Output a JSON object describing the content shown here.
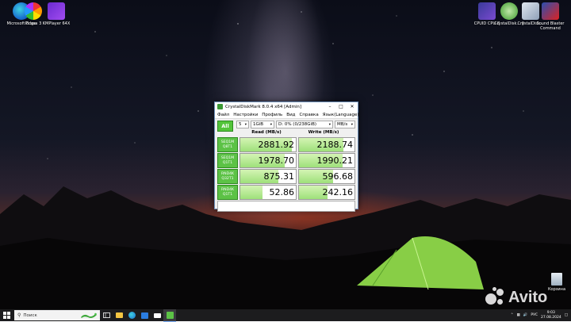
{
  "desktop": {
    "icons_left": [
      {
        "label": "Microsoft Edge",
        "icon": "edge-icon"
      },
      {
        "label": "Picasa 3",
        "icon": "picasa-icon"
      },
      {
        "label": "KMPlayer 64X",
        "icon": "kmplayer-icon"
      }
    ],
    "icons_right": [
      {
        "label": "CPUID CPU-Z",
        "icon": "cpuz-icon"
      },
      {
        "label": "CrystalDisk... 8",
        "icon": "crystaldisk-icon"
      },
      {
        "label": "CrystalDisk...",
        "icon": "crystaldisk-icon"
      },
      {
        "label": "Sound Blaster Command",
        "icon": "soundblaster-icon"
      }
    ],
    "recycle_bin": "Корзина"
  },
  "window": {
    "title": "CrystalDiskMark 8.0.4 x64 [Admin]",
    "menu": [
      "Файл",
      "Настройки",
      "Профиль",
      "Вид",
      "Справка",
      "Язык(Language)"
    ],
    "all_button": "All",
    "count": "5",
    "size": "1GiB",
    "drive": "D: 0% (0/238GiB)",
    "unit": "MB/s",
    "read_header": "Read (MB/s)",
    "write_header": "Write (MB/s)",
    "rows": [
      {
        "l1": "SEQ1M",
        "l2": "Q8T1",
        "read": "2881.92",
        "write": "2188.74",
        "read_frac": 0.93,
        "write_frac": 0.8
      },
      {
        "l1": "SEQ1M",
        "l2": "Q1T1",
        "read": "1978.70",
        "write": "1990.21",
        "read_frac": 0.8,
        "write_frac": 0.79
      },
      {
        "l1": "RND4K",
        "l2": "Q32T1",
        "read": "875.31",
        "write": "596.68",
        "read_frac": 0.68,
        "write_frac": 0.62
      },
      {
        "l1": "RND4K",
        "l2": "Q1T1",
        "read": "52.86",
        "write": "242.16",
        "read_frac": 0.4,
        "write_frac": 0.52
      }
    ]
  },
  "taskbar": {
    "search_placeholder": "Поиск",
    "lang": "РУС",
    "time": "9:03",
    "date": "27.08.2024"
  },
  "watermark": "Avito"
}
